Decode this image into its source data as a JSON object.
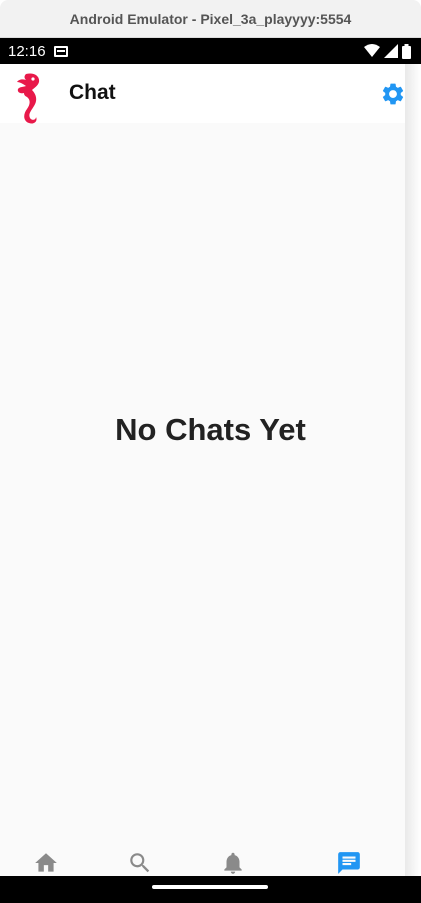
{
  "window": {
    "title": "Android Emulator - Pixel_3a_playyyy:5554"
  },
  "status_bar": {
    "time": "12:16"
  },
  "app_bar": {
    "title": "Chat",
    "logo_icon": "seahorse-logo-icon",
    "settings_icon": "gear-icon",
    "settings_color": "#2196F3"
  },
  "main": {
    "empty_message": "No Chats Yet"
  },
  "bottom_nav": {
    "items": [
      {
        "name": "home",
        "icon": "home-icon",
        "color": "#8a8a8a"
      },
      {
        "name": "search",
        "icon": "search-icon",
        "color": "#8a8a8a"
      },
      {
        "name": "notifications",
        "icon": "bell-icon",
        "color": "#8a8a8a"
      },
      {
        "name": "chat",
        "icon": "chat-icon",
        "color": "#2196F3",
        "selected": true
      }
    ]
  },
  "colors": {
    "brand": "#E8194A",
    "accent": "#2196F3"
  }
}
